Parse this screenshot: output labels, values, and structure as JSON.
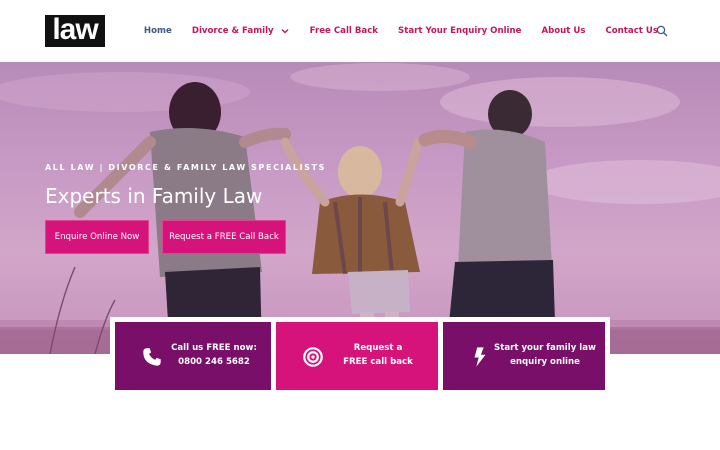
{
  "logo": {
    "text": "law"
  },
  "nav": {
    "items": [
      {
        "label": "Home",
        "active": true
      },
      {
        "label": "Divorce & Family",
        "has_dropdown": true
      },
      {
        "label": "Free Call Back"
      },
      {
        "label": "Start Your Enquiry Online"
      },
      {
        "label": "About Us"
      },
      {
        "label": "Contact Us"
      }
    ],
    "search_icon": "search-icon"
  },
  "hero": {
    "eyebrow": "ALL LAW | DIVORCE & FAMILY LAW SPECIALISTS",
    "title": "Experts in Family Law",
    "buttons": {
      "enquire": "Enquire Online Now",
      "callback": "Request a FREE Call Back"
    }
  },
  "cta": [
    {
      "icon": "phone-icon",
      "line1": "Call us FREE now:",
      "line2": "0800 246 5682"
    },
    {
      "icon": "target-icon",
      "line1": "Request a",
      "line2": "FREE call back"
    },
    {
      "icon": "lightning-icon",
      "line1": "Start your family law",
      "line2": "enquiry online"
    }
  ],
  "colors": {
    "brand_pink": "#d6137a",
    "brand_purple": "#7a0f6a",
    "nav_pink": "#c2185b",
    "nav_active": "#3f5a82"
  }
}
